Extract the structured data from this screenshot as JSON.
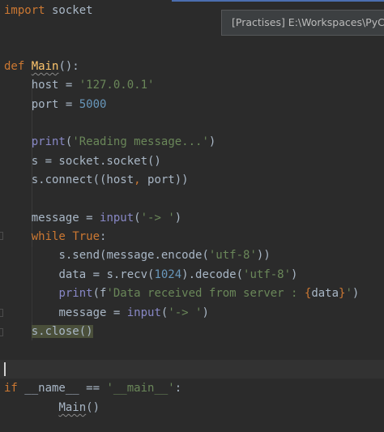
{
  "tooltip": {
    "path_text": "[Practises] E:\\Workspaces\\PyCh"
  },
  "code": {
    "line1": {
      "kw": "import",
      "rest": " socket"
    },
    "def_line": {
      "kw": "def",
      "name": "Main",
      "rest": "():"
    },
    "host_line": {
      "lhs": "    host = ",
      "value": "'127.0.0.1'"
    },
    "port_line": {
      "lhs": "    port = ",
      "value": "5000"
    },
    "print1": {
      "fn": "print",
      "open": "(",
      "str": "'Reading message...'",
      "close": ")"
    },
    "socket_line": {
      "text": "    s = socket.socket()"
    },
    "connect_line": {
      "a": "    s.connect((host",
      "comma": ",",
      "b": " port))"
    },
    "message_line": {
      "lhs": "    message = ",
      "fn": "input",
      "open": "(",
      "str": "'-> '",
      "close": ")"
    },
    "while_line": {
      "kw_while": "while",
      "sp": " ",
      "kw_true": "True",
      "colon": ":"
    },
    "send_line": {
      "a": "s.send(message.encode(",
      "str": "'utf-8'",
      "b": "))"
    },
    "recv_line": {
      "a": "data = s.recv(",
      "num": "1024",
      "b": ").decode(",
      "str": "'utf-8'",
      "c": ")"
    },
    "print2": {
      "fn": "print",
      "a": "(f",
      "str1": "'Data received from server : ",
      "brace_open": "{",
      "var": "data",
      "brace_close": "}",
      "str2": "'",
      "close": ")"
    },
    "message2_line": {
      "lhs": "message = ",
      "fn": "input",
      "open": "(",
      "str": "'-> '",
      "close": ")"
    },
    "close_line": {
      "text": "s.close()"
    },
    "if_line": {
      "kw": "if",
      "mid": " __name__ == ",
      "str": "'__main__'",
      "colon": ":"
    },
    "main_call": {
      "name": "Main",
      "rest": "()"
    }
  }
}
